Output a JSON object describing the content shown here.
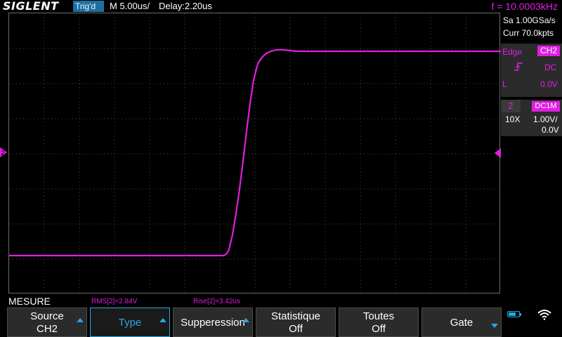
{
  "header": {
    "brand": "SIGLENT",
    "trig_status": "Trig'd",
    "timebase": "M 5.00us/",
    "delay": "Delay:2.20us",
    "frequency": "f = 10.0003kHz"
  },
  "acquisition": {
    "sample_rate": "Sa 1.00GSa/s",
    "memory_depth": "Curr 70.0kpts"
  },
  "trigger": {
    "type": "Edge",
    "source": "CH2",
    "coupling": "DC",
    "level_label": "L",
    "level": "0.0V",
    "slope_icon": "rising-edge-icon"
  },
  "channel": {
    "number": "2",
    "coupling": "DC1M",
    "probe": "10X",
    "scale": "1.00V/",
    "offset": "0.0V",
    "color": "#e01fe0"
  },
  "measure": {
    "title": "MESURE",
    "items": [
      "RMS[2]=2.84V",
      "Rise[2]=3.42us"
    ]
  },
  "softkeys": [
    {
      "line1": "Source",
      "line2": "CH2"
    },
    {
      "line1": "Type",
      "line2": ""
    },
    {
      "line1": "Supperession",
      "line2": ""
    },
    {
      "line1": "Statistique",
      "line2": "Off"
    },
    {
      "line1": "Toutes",
      "line2": "Off"
    },
    {
      "line1": "Gate",
      "line2": ""
    }
  ],
  "colors": {
    "accent": "#27a8e0",
    "channel2": "#e01fe0",
    "grid": "#5a5a5a"
  }
}
